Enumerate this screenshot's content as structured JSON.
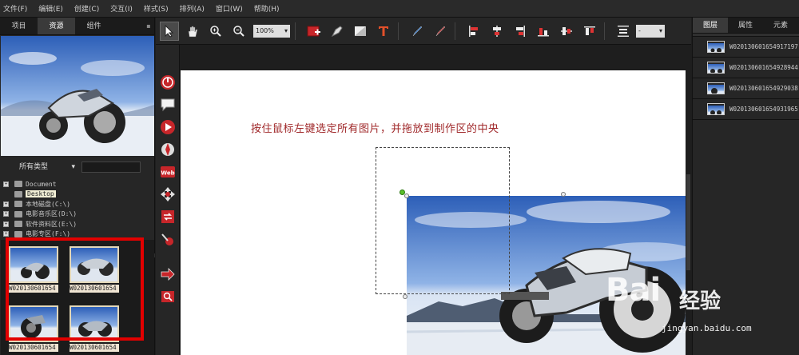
{
  "menubar": {
    "items": [
      "文件(F)",
      "编辑(E)",
      "创建(C)",
      "交互(I)",
      "样式(S)",
      "排列(A)",
      "窗口(W)",
      "帮助(H)"
    ]
  },
  "left_panel": {
    "tabs": [
      "项目",
      "资源",
      "组件"
    ],
    "active_tab": "资源",
    "filter": {
      "type_value": "所有类型"
    },
    "tree": [
      {
        "label": "Document",
        "expandable": true
      },
      {
        "label": "Desktop",
        "expandable": false,
        "selected": true
      },
      {
        "label": "本地磁盘(C:\\)",
        "expandable": true
      },
      {
        "label": "电影音乐区(D:\\)",
        "expandable": true
      },
      {
        "label": "软件资料区(E:\\)",
        "expandable": true
      },
      {
        "label": "电影专区(F:\\)",
        "expandable": true
      }
    ],
    "thumbnails": [
      {
        "caption": "W020130601654"
      },
      {
        "caption": "W020130601654"
      },
      {
        "caption": "W020130601654"
      },
      {
        "caption": "W020130601654"
      }
    ]
  },
  "toolbar": {
    "zoom": "100%",
    "spacing_value": "-"
  },
  "canvas": {
    "instruction": "按住鼠标左键选定所有图片，并拖放到制作区的中央"
  },
  "right_panel": {
    "tabs": [
      "图层",
      "属性",
      "元素"
    ],
    "active_tab": "图层",
    "layers": [
      {
        "name": "W020130601654917197"
      },
      {
        "name": "W020130601654928944"
      },
      {
        "name": "W020130601654929038"
      },
      {
        "name": "W020130601654931965"
      }
    ]
  },
  "watermark": {
    "logo": "Bai",
    "logo_cn": "经验",
    "url": "jingyan.baidu.com"
  },
  "colors": {
    "highlight_red": "#e20000",
    "instruction_text": "#a0282a",
    "panel_bg": "#262626"
  }
}
